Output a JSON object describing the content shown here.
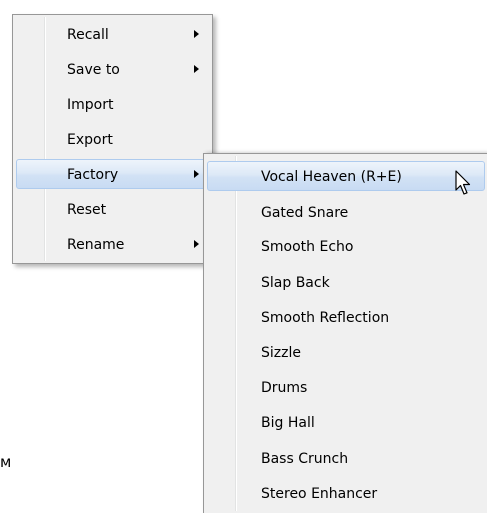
{
  "background_text": "м",
  "main_menu": {
    "items": [
      {
        "label": "Recall",
        "submenu": true
      },
      {
        "label": "Save to",
        "submenu": true
      },
      {
        "label": "Import",
        "submenu": false
      },
      {
        "label": "Export",
        "submenu": false
      },
      {
        "label": "Factory",
        "submenu": true,
        "highlighted": true
      },
      {
        "label": "Reset",
        "submenu": false
      },
      {
        "label": "Rename",
        "submenu": true
      }
    ]
  },
  "factory_submenu": {
    "items": [
      {
        "label": "Vocal Heaven (R+E)",
        "highlighted": true
      },
      {
        "label": "Gated Snare"
      },
      {
        "label": "Smooth Echo"
      },
      {
        "label": "Slap Back"
      },
      {
        "label": "Smooth Reflection"
      },
      {
        "label": "Sizzle"
      },
      {
        "label": "Drums"
      },
      {
        "label": "Big Hall"
      },
      {
        "label": "Bass Crunch"
      },
      {
        "label": "Stereo Enhancer"
      }
    ]
  },
  "colors": {
    "menu_bg": "#f0f0f0",
    "highlight_border": "#aecbee",
    "highlight_fill": "#dde9f7"
  }
}
